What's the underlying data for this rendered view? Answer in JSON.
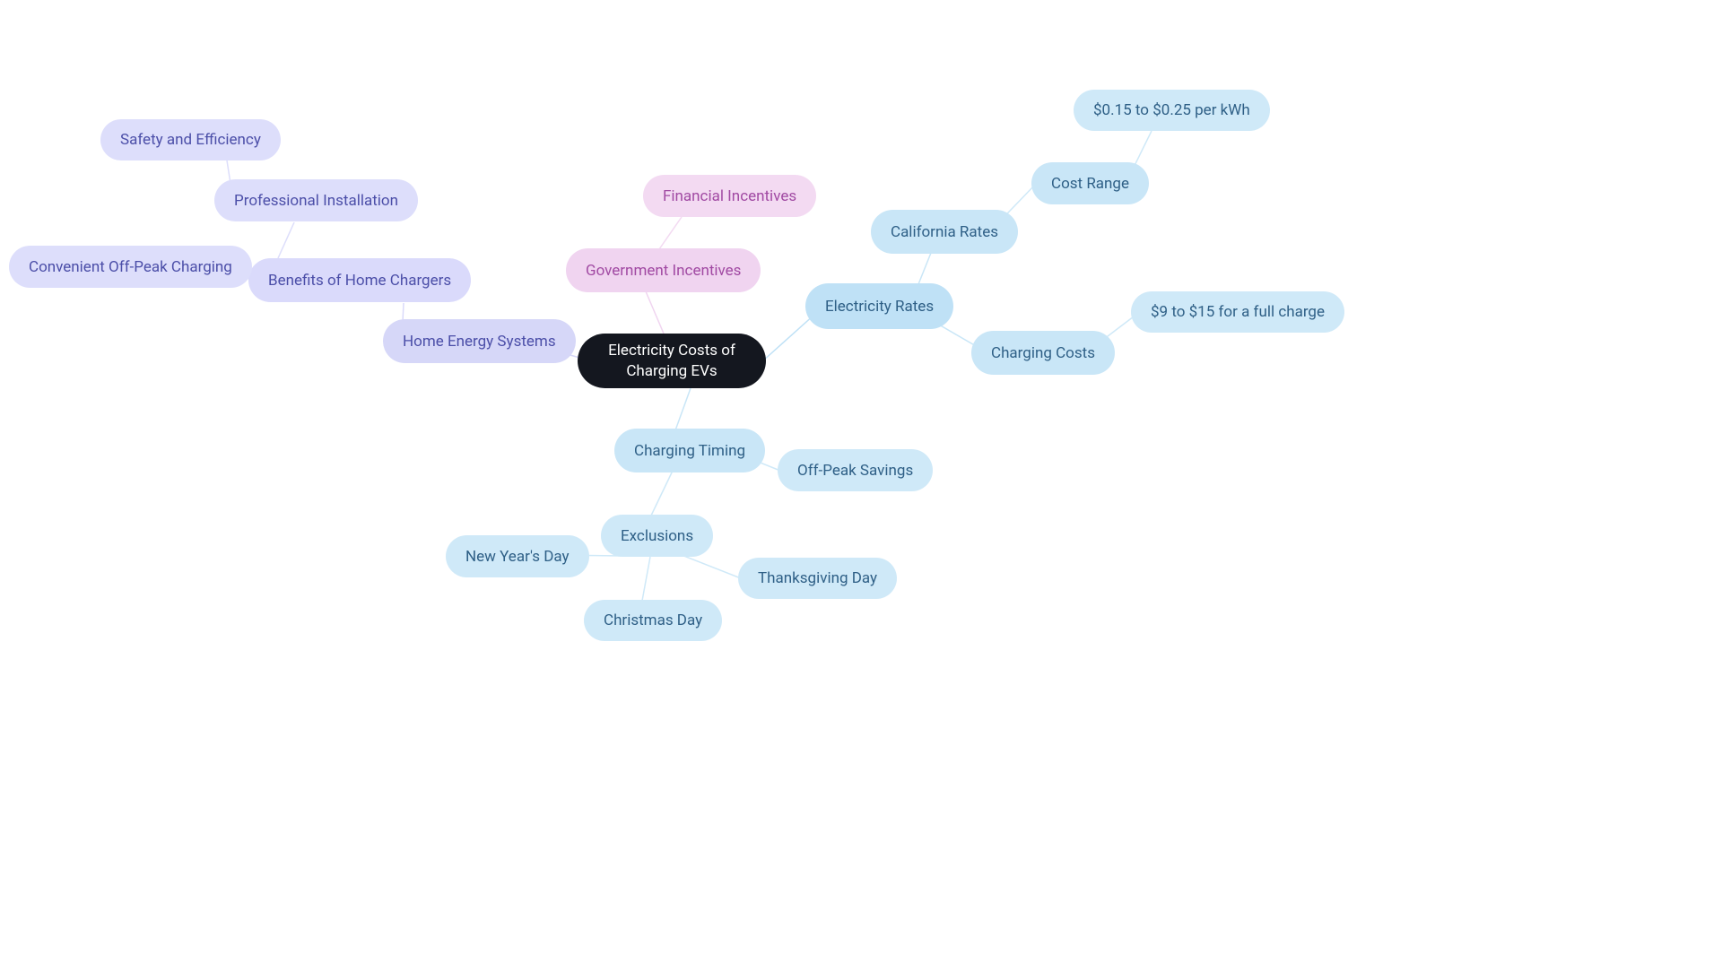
{
  "root": {
    "label": "Electricity Costs of Charging EVs"
  },
  "electricity_rates": {
    "label": "Electricity Rates",
    "california_rates": {
      "label": "California Rates",
      "cost_range": {
        "label": "Cost Range",
        "value": "$0.15 to $0.25 per kWh"
      }
    },
    "charging_costs": {
      "label": "Charging Costs",
      "value": "$9 to $15 for a full charge"
    }
  },
  "charging_timing": {
    "label": "Charging Timing",
    "off_peak": {
      "label": "Off-Peak Savings"
    },
    "exclusions": {
      "label": "Exclusions",
      "new_years": "New Year's Day",
      "christmas": "Christmas Day",
      "thanksgiving": "Thanksgiving Day"
    }
  },
  "government_incentives": {
    "label": "Government Incentives",
    "financial": "Financial Incentives"
  },
  "home_energy": {
    "label": "Home Energy Systems",
    "benefits": {
      "label": "Benefits of Home Chargers",
      "off_peak": "Convenient Off-Peak Charging",
      "installation": {
        "label": "Professional Installation",
        "safety": "Safety and Efficiency"
      }
    }
  },
  "colors": {
    "root_bg": "#14171f",
    "blue": "#bfe1f6",
    "purple": "#d6d7f8",
    "pink": "#f0d4f0"
  }
}
